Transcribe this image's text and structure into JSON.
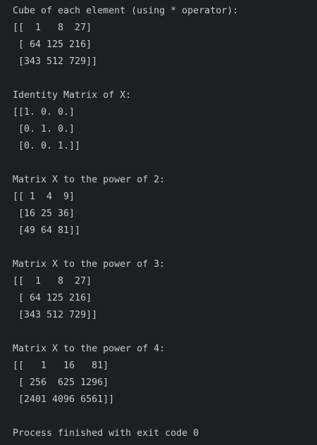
{
  "console": {
    "lines": [
      "Cube of each element (using * operator):",
      "[[  1   8  27]",
      " [ 64 125 216]",
      " [343 512 729]]",
      "",
      "Identity Matrix of X:",
      "[[1. 0. 0.]",
      " [0. 1. 0.]",
      " [0. 0. 1.]]",
      "",
      "Matrix X to the power of 2:",
      "[[ 1  4  9]",
      " [16 25 36]",
      " [49 64 81]]",
      "",
      "Matrix X to the power of 3:",
      "[[  1   8  27]",
      " [ 64 125 216]",
      " [343 512 729]]",
      "",
      "Matrix X to the power of 4:",
      "[[   1   16   81]",
      " [ 256  625 1296]",
      " [2401 4096 6561]]",
      "",
      "Process finished with exit code 0"
    ]
  }
}
